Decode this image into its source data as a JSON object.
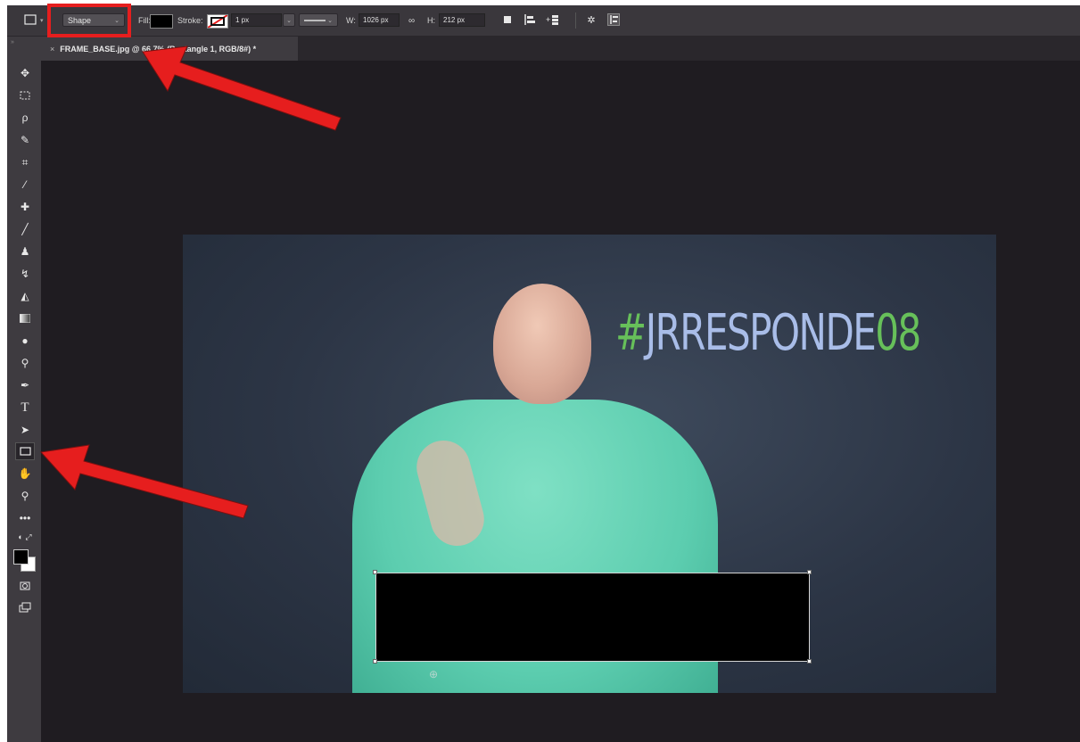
{
  "options_bar": {
    "mode_select": "Shape",
    "fill_label": "Fill:",
    "stroke_label": "Stroke:",
    "stroke_width": "1 px",
    "width_label": "W:",
    "width_value": "1026 px",
    "height_label": "H:",
    "height_value": "212 px",
    "link_icon": "link-icon"
  },
  "document_tab": {
    "close": "×",
    "title": "FRAME_BASE.jpg @ 66.7% (Rectangle 1, RGB/8#) *"
  },
  "toolbar": {
    "tools": [
      "move",
      "marquee",
      "lasso",
      "quick-select",
      "crop",
      "eyedropper",
      "healing",
      "brush",
      "stamp",
      "history-brush",
      "eraser",
      "gradient",
      "blur",
      "dodge",
      "pen",
      "type",
      "path-select",
      "rectangle",
      "hand",
      "zoom",
      "more",
      "default-colors",
      "foreground-background",
      "quick-mask",
      "screen-mode"
    ],
    "active_tool": "rectangle"
  },
  "canvas": {
    "hashtag_text_hash": "#",
    "hashtag_text_main": "JRRESPONDE",
    "hashtag_text_num": "08"
  },
  "colors": {
    "annotation": "#e61e1e",
    "app_bg": "#1f1c21",
    "panel": "#3e3b40"
  }
}
